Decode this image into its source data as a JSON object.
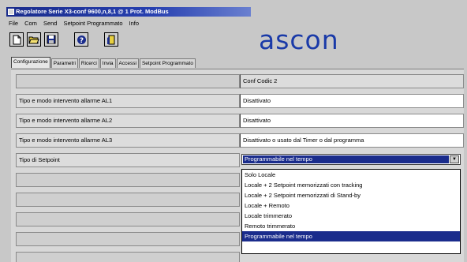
{
  "window": {
    "title": "Regolatore Serie X3-conf 9600,n,8,1 @ 1 Prot. ModBus"
  },
  "menu": {
    "items": [
      "File",
      "Com",
      "Send",
      "Setpoint Programmato",
      "Info"
    ]
  },
  "toolbar": {
    "buttons": [
      {
        "icon": "new-document-icon"
      },
      {
        "icon": "open-folder-icon"
      },
      {
        "icon": "save-disk-icon"
      },
      {
        "icon": "help-icon"
      },
      {
        "icon": "exit-door-icon"
      }
    ]
  },
  "brand": {
    "logo_text": "ascon",
    "color": "#1a3aa8"
  },
  "tabs": [
    {
      "label": "Configurazione",
      "active": true
    },
    {
      "label": "Parametri"
    },
    {
      "label": "Ricerci"
    },
    {
      "label": "Invia"
    },
    {
      "label": "Accessi"
    },
    {
      "label": "Setpoint Programmato"
    }
  ],
  "grid": {
    "header_value": "Conf Codic 2",
    "rows": [
      {
        "label": "Tipo e modo intervento allarme AL1",
        "value": "Disattivato"
      },
      {
        "label": "Tipo e modo intervento allarme AL2",
        "value": "Disattivato"
      },
      {
        "label": "Tipo e modo intervento allarme AL3",
        "value": "Disattivato o usato dal Timer o dal programma"
      },
      {
        "label": "Tipo di Setpoint",
        "value": "Programmabile nel tempo"
      }
    ]
  },
  "dropdown": {
    "selected": "Programmabile nel tempo",
    "options": [
      "Solo Locale",
      "Locale + 2 Setpoint memorizzati con tracking",
      "Locale + 2 Setpoint memorizzati di Stand-by",
      "Locale + Remoto",
      "Locale trimmerato",
      "Remoto trimmerato",
      "Programmabile nel tempo"
    ]
  },
  "colors": {
    "selection": "#1a2c8c",
    "titlebar": "#1a2c8c",
    "background": "#c8c8c8"
  }
}
